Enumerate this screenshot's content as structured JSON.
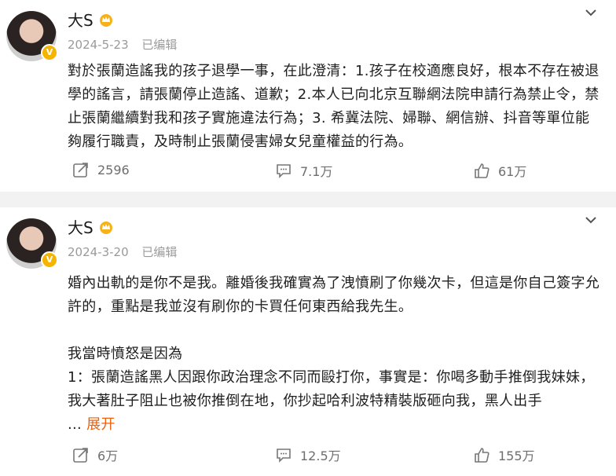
{
  "posts": [
    {
      "user_name": "大S",
      "date": "2024-5-23",
      "edited_label": "已编辑",
      "paragraphs": [
        "對於張蘭造謠我的孩子退學一事，在此澄清：1.孩子在校適應良好，根本不存在被退學的謠言，請張蘭停止造謠、道歉；2.本人已向北京互聯網法院申請行為禁止令，禁止張蘭繼續對我和孩子實施違法行為；3. 希冀法院、婦聯、網信辦、抖音等單位能夠履行職責，及時制止張蘭侵害婦女兒童權益的行為。"
      ],
      "reposts": "2596",
      "comments": "7.1万",
      "likes": "61万"
    },
    {
      "user_name": "大S",
      "date": "2024-3-20",
      "edited_label": "已编辑",
      "paragraphs": [
        "婚內出軌的是你不是我。離婚後我確實為了洩憤刷了你幾次卡，但這是你自己簽字允許的，重點是我並沒有刷你的卡買任何東西給我先生。",
        "我當時憤怒是因為",
        "1：張蘭造謠黑人因跟你政治理念不同而毆打你，事實是：你喝多動手推倒我妹妹，我大著肚子阻止也被你推倒在地，你抄起哈利波特精裝版砸向我，黑人出手"
      ],
      "ellipsis": "...",
      "expand_label": "展开",
      "reposts": "6万",
      "comments": "12.5万",
      "likes": "155万"
    }
  ],
  "icons": {
    "verified": "verified-badge-icon",
    "crown": "crown-icon",
    "chevron": "chevron-down-icon",
    "repost": "repost-icon",
    "comment": "comment-icon",
    "like": "thumbs-up-icon"
  },
  "colors": {
    "expand_link": "#e8620e",
    "verified_badge": "#f5b400",
    "meta_text": "#9a9a9a"
  }
}
